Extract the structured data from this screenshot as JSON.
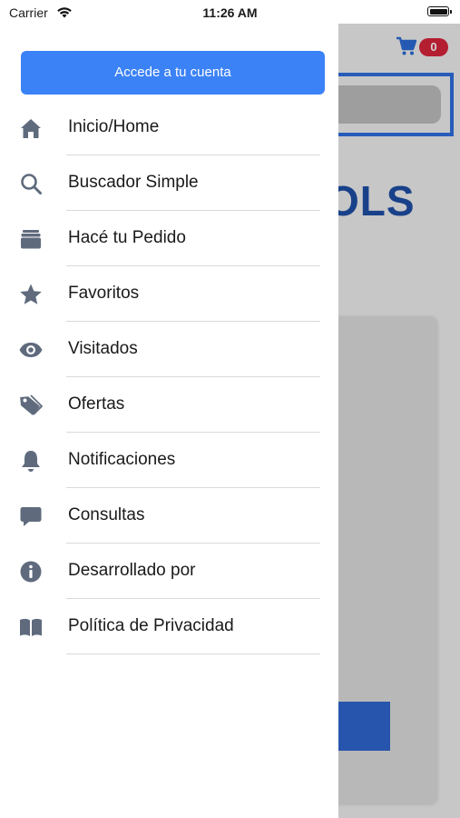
{
  "status_bar": {
    "carrier": "Carrier",
    "time": "11:26 AM"
  },
  "background": {
    "cart_count": "0",
    "logo_partial": "OLS"
  },
  "drawer": {
    "login_label": "Accede a tu cuenta",
    "items": [
      {
        "label": "Inicio/Home",
        "icon": "home-icon"
      },
      {
        "label": "Buscador Simple",
        "icon": "search-icon"
      },
      {
        "label": "Hacé tu Pedido",
        "icon": "box-icon"
      },
      {
        "label": "Favoritos",
        "icon": "star-icon"
      },
      {
        "label": "Visitados",
        "icon": "eye-icon"
      },
      {
        "label": "Ofertas",
        "icon": "tag-icon"
      },
      {
        "label": "Notificaciones",
        "icon": "bell-icon"
      },
      {
        "label": "Consultas",
        "icon": "chat-icon"
      },
      {
        "label": "Desarrollado por",
        "icon": "info-icon"
      },
      {
        "label": "Política de Privacidad",
        "icon": "book-icon"
      }
    ]
  },
  "colors": {
    "accent": "#3b82f6",
    "icon": "#5f6b7d",
    "badge": "#d9253b"
  }
}
